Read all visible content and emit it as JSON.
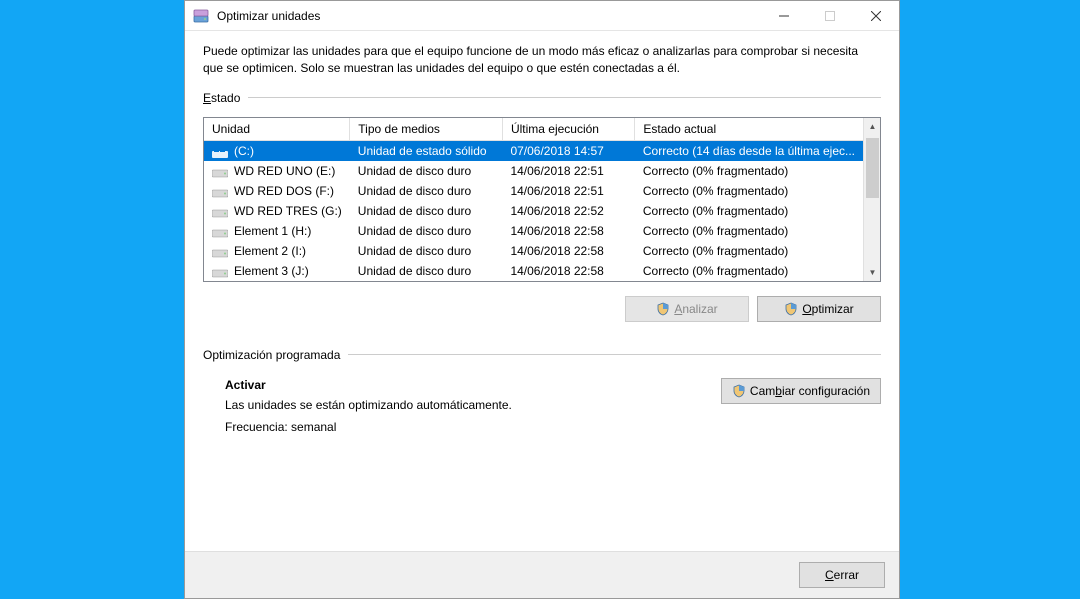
{
  "window": {
    "title": "Optimizar unidades"
  },
  "description": "Puede optimizar las unidades para que el equipo funcione de un modo más eficaz o analizarlas para comprobar si necesita que se optimicen. Solo se muestran las unidades del equipo o que estén conectadas a él.",
  "sections": {
    "status_prefix": "E",
    "status_suffix": "stado",
    "scheduled": "Optimización programada"
  },
  "columns": {
    "unit": "Unidad",
    "media": "Tipo de medios",
    "last": "Última ejecución",
    "state": "Estado actual"
  },
  "rows": [
    {
      "name": "(C:)",
      "media": "Unidad de estado sólido",
      "last": "07/06/2018 14:57",
      "state": "Correcto (14 días desde la última ejec...",
      "selected": true,
      "system": true
    },
    {
      "name": "WD RED UNO (E:)",
      "media": "Unidad de disco duro",
      "last": "14/06/2018 22:51",
      "state": "Correcto (0% fragmentado)",
      "selected": false,
      "system": false
    },
    {
      "name": "WD RED DOS (F:)",
      "media": "Unidad de disco duro",
      "last": "14/06/2018 22:51",
      "state": "Correcto (0% fragmentado)",
      "selected": false,
      "system": false
    },
    {
      "name": "WD RED TRES (G:)",
      "media": "Unidad de disco duro",
      "last": "14/06/2018 22:52",
      "state": "Correcto (0% fragmentado)",
      "selected": false,
      "system": false
    },
    {
      "name": "Element 1 (H:)",
      "media": "Unidad de disco duro",
      "last": "14/06/2018 22:58",
      "state": "Correcto (0% fragmentado)",
      "selected": false,
      "system": false
    },
    {
      "name": "Element 2 (I:)",
      "media": "Unidad de disco duro",
      "last": "14/06/2018 22:58",
      "state": "Correcto (0% fragmentado)",
      "selected": false,
      "system": false
    },
    {
      "name": "Element 3 (J:)",
      "media": "Unidad de disco duro",
      "last": "14/06/2018 22:58",
      "state": "Correcto (0% fragmentado)",
      "selected": false,
      "system": false
    }
  ],
  "buttons": {
    "analyze_prefix": "A",
    "analyze_suffix": "nalizar",
    "optimize_prefix": "O",
    "optimize_suffix": "ptimizar",
    "change_prefix": "Cam",
    "change_mid": "b",
    "change_suffix": "iar configuración",
    "close_prefix": "C",
    "close_suffix": "errar"
  },
  "scheduled": {
    "activate": "Activar",
    "desc": "Las unidades se están optimizando automáticamente.",
    "freq": "Frecuencia: semanal"
  }
}
